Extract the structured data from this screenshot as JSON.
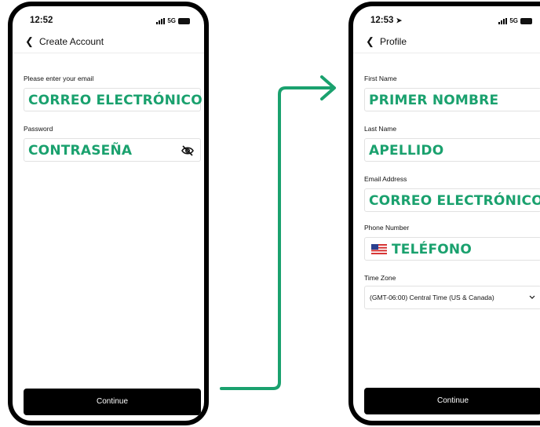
{
  "left_screen": {
    "status": {
      "time": "12:52",
      "network": "5G"
    },
    "nav": {
      "back_icon": "chevron-left-icon",
      "title": "Create Account"
    },
    "email": {
      "label": "Please enter your email",
      "value": "CORREO ELECTRÓNICO"
    },
    "password": {
      "label": "Password",
      "value": "CONTRASEÑA",
      "icon": "eye-slash-icon"
    },
    "continue_label": "Continue"
  },
  "right_screen": {
    "status": {
      "time": "12:53",
      "network": "5G"
    },
    "nav": {
      "back_icon": "chevron-left-icon",
      "title": "Profile"
    },
    "first_name": {
      "label": "First Name",
      "value": "PRIMER NOMBRE"
    },
    "last_name": {
      "label": "Last Name",
      "value": "APELLIDO"
    },
    "email": {
      "label": "Email Address",
      "value": "CORREO ELECTRÓNICO"
    },
    "phone": {
      "label": "Phone Number",
      "value": "TELÉFONO",
      "flag_icon": "us-flag-icon"
    },
    "time_zone": {
      "label": "Time Zone",
      "value": "(GMT-06:00) Central Time (US & Canada)"
    },
    "continue_label": "Continue"
  },
  "colors": {
    "accent": "#1aa16e",
    "button": "#000000",
    "border": "#e2e2e2"
  }
}
